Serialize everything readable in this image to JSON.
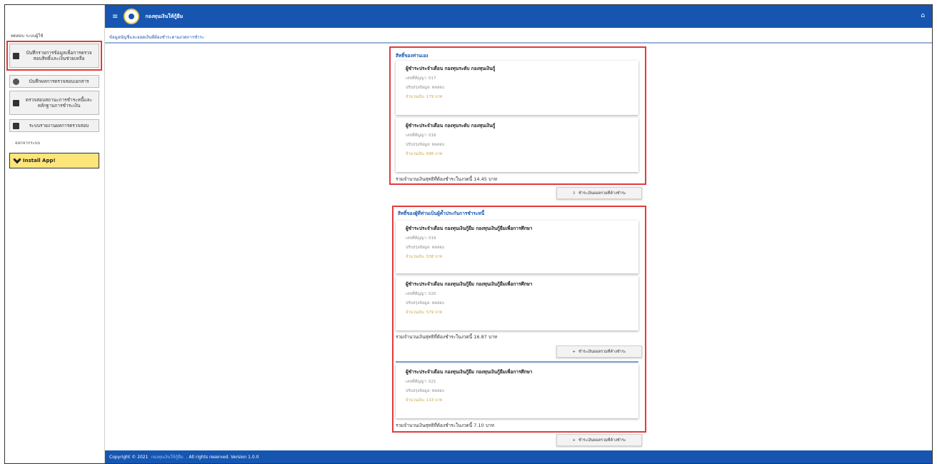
{
  "app": {
    "title": "กองทุนเงินให้กู้ยืม",
    "menu_icon": "hamburger-icon",
    "bell_icon": "bell-icon"
  },
  "sidebar": {
    "user": "ทดสอบ ระบบผู้ใช้",
    "items": [
      {
        "label": "บันทึกรายการข้อมูลเพื่อการตรวจสอบสิทธิ์และเงินช่วยเหลือ",
        "icon": "document-icon"
      },
      {
        "label": "บันทึกผลการตรวจสอบเอกสาร",
        "icon": "refresh-icon"
      },
      {
        "label": "ตรวจสอบสถานะการชำระหนี้และหลักฐานการชำระเงิน",
        "icon": "car-icon"
      },
      {
        "label": "ระบบรายงานผลการตรวจสอบ",
        "icon": "report-icon"
      }
    ],
    "sub_label": "ออกจากระบบ",
    "install_label": "Install App!"
  },
  "breadcrumb": "ข้อมูลบัญชีและยอดเงินที่ต้องชำระตามงวดการชำระ",
  "section1": {
    "title": "สิทธิ์ของท่านเอง",
    "cards": [
      {
        "head": "ผู้ชำระประจำเดือน กองทุนระดับ กองทุนเงินกู้",
        "line1": "เลขที่สัญญา: 017",
        "line2": "ปรับปรุงข้อมูล: ทดสอบ",
        "amount": "จำนวนเงิน: 179 บาท"
      },
      {
        "head": "ผู้ชำระประจำเดือน กองทุนระดับ กองทุนเงินกู้",
        "line1": "เลขที่สัญญา: 018",
        "line2": "ปรับปรุงข้อมูล: ทดสอบ",
        "amount": "จำนวนเงิน: 696 บาท"
      }
    ],
    "total": "รวมจำนวนเงินสุทธิที่ต้องชำระในงวดนี้ 14.45 บาท",
    "button": "ชำระเงินยอดรวมที่ค้างชำระ"
  },
  "section2": {
    "title": "สิทธิ์ของผู้ที่ท่านเป็นผู้ค้ำประกันการชำระหนี้",
    "cards": [
      {
        "head": "ผู้ชำระประจำเดือน กองทุนเงินกู้ยืม กองทุนเงินกู้ยืมเพื่อการศึกษา",
        "line1": "เลขที่สัญญา: 019",
        "line2": "ปรับปรุงข้อมูล: ทดสอบ",
        "amount": "จำนวนเงิน: 538 บาท"
      },
      {
        "head": "ผู้ชำระประจำเดือน กองทุนเงินกู้ยืม กองทุนเงินกู้ยืมเพื่อการศึกษา",
        "line1": "เลขที่สัญญา: 020",
        "line2": "ปรับปรุงข้อมูล: ทดสอบ",
        "amount": "จำนวนเงิน: 579 บาท"
      }
    ],
    "total": "รวมจำนวนเงินสุทธิที่ต้องชำระในงวดนี้ 16.87 บาท",
    "button": "ชำระเงินยอดรวมที่ค้างชำระ",
    "card3": {
      "head": "ผู้ชำระประจำเดือน กองทุนเงินกู้ยืม กองทุนเงินกู้ยืมเพื่อการศึกษา",
      "line1": "เลขที่สัญญา: 021",
      "line2": "ปรับปรุงข้อมูล: ทดสอบ",
      "amount": "จำนวนเงิน: 133 บาท"
    },
    "total2": "รวมจำนวนเงินสุทธิที่ต้องชำระในงวดนี้ 7.10 บาท",
    "button2": "ชำระเงินยอดรวมที่ค้างชำระ"
  },
  "footer": {
    "copyright": "Copyright © 2021",
    "org": "กองทุนเงินให้กู้ยืม",
    "rights": ". All rights reserved. Version 1.0.0"
  }
}
